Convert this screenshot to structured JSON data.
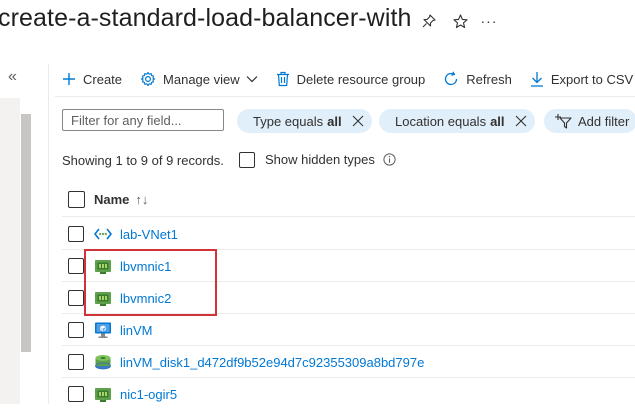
{
  "header": {
    "title": "create-a-standard-load-balancer-with",
    "pin_icon": "pin-icon",
    "favorite_icon": "star-icon",
    "more_label": "···"
  },
  "sidebar": {
    "collapse_label": "«"
  },
  "toolbar": {
    "create_label": "Create",
    "manage_view_label": "Manage view",
    "delete_label": "Delete resource group",
    "refresh_label": "Refresh",
    "export_label": "Export to CSV"
  },
  "filters": {
    "placeholder": "Filter for any field...",
    "type_prefix": "Type equals",
    "type_value": "all",
    "location_prefix": "Location equals",
    "location_value": "all",
    "add_filter_label": "Add filter"
  },
  "summary": {
    "records_text": "Showing 1 to 9 of 9 records.",
    "show_hidden_label": "Show hidden types"
  },
  "table": {
    "name_header": "Name",
    "sort_indicator": "↑↓",
    "rows": [
      {
        "name": "lab-VNet1",
        "icon": "virtual-network-icon"
      },
      {
        "name": "lbvmnic1",
        "icon": "network-interface-icon"
      },
      {
        "name": "lbvmnic2",
        "icon": "network-interface-icon"
      },
      {
        "name": "linVM",
        "icon": "virtual-machine-icon"
      },
      {
        "name": "linVM_disk1_d472df9b52e94d7c92355309a8bd797e",
        "icon": "disk-icon"
      },
      {
        "name": "nic1-ogir5",
        "icon": "network-interface-icon"
      }
    ]
  },
  "colors": {
    "accent": "#0078d4",
    "pill_bg": "#e1effa",
    "highlight": "#d13438",
    "nic_green": "#5ea04b"
  }
}
